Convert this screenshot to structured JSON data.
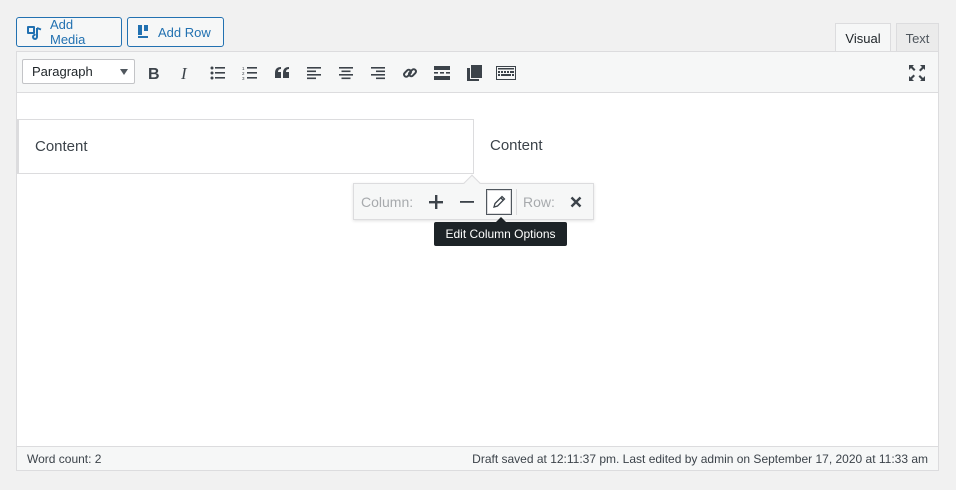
{
  "buttons": {
    "add_media": "Add Media",
    "add_row": "Add Row"
  },
  "tabs": {
    "visual": "Visual",
    "text": "Text"
  },
  "toolbar": {
    "format_value": "Paragraph",
    "icons": [
      "bold-icon",
      "italic-icon",
      "bulleted-list-icon",
      "numbered-list-icon",
      "blockquote-icon",
      "align-left-icon",
      "align-center-icon",
      "align-right-icon",
      "link-icon",
      "read-more-icon",
      "toggle-toolbar-icon",
      "keyboard-icon",
      "fullscreen-icon"
    ]
  },
  "columns": [
    {
      "text": "Content"
    },
    {
      "text": "Content"
    }
  ],
  "column_toolbar": {
    "column_label": "Column:",
    "row_label": "Row:",
    "tooltip": "Edit Column Options"
  },
  "status": {
    "word_count": "Word count: 2",
    "draft": "Draft saved at 12:11:37 pm. Last edited by admin on September 17, 2020 at 11:33 am"
  },
  "colors": {
    "accent": "#2271b1",
    "background": "#f1f1f1"
  }
}
